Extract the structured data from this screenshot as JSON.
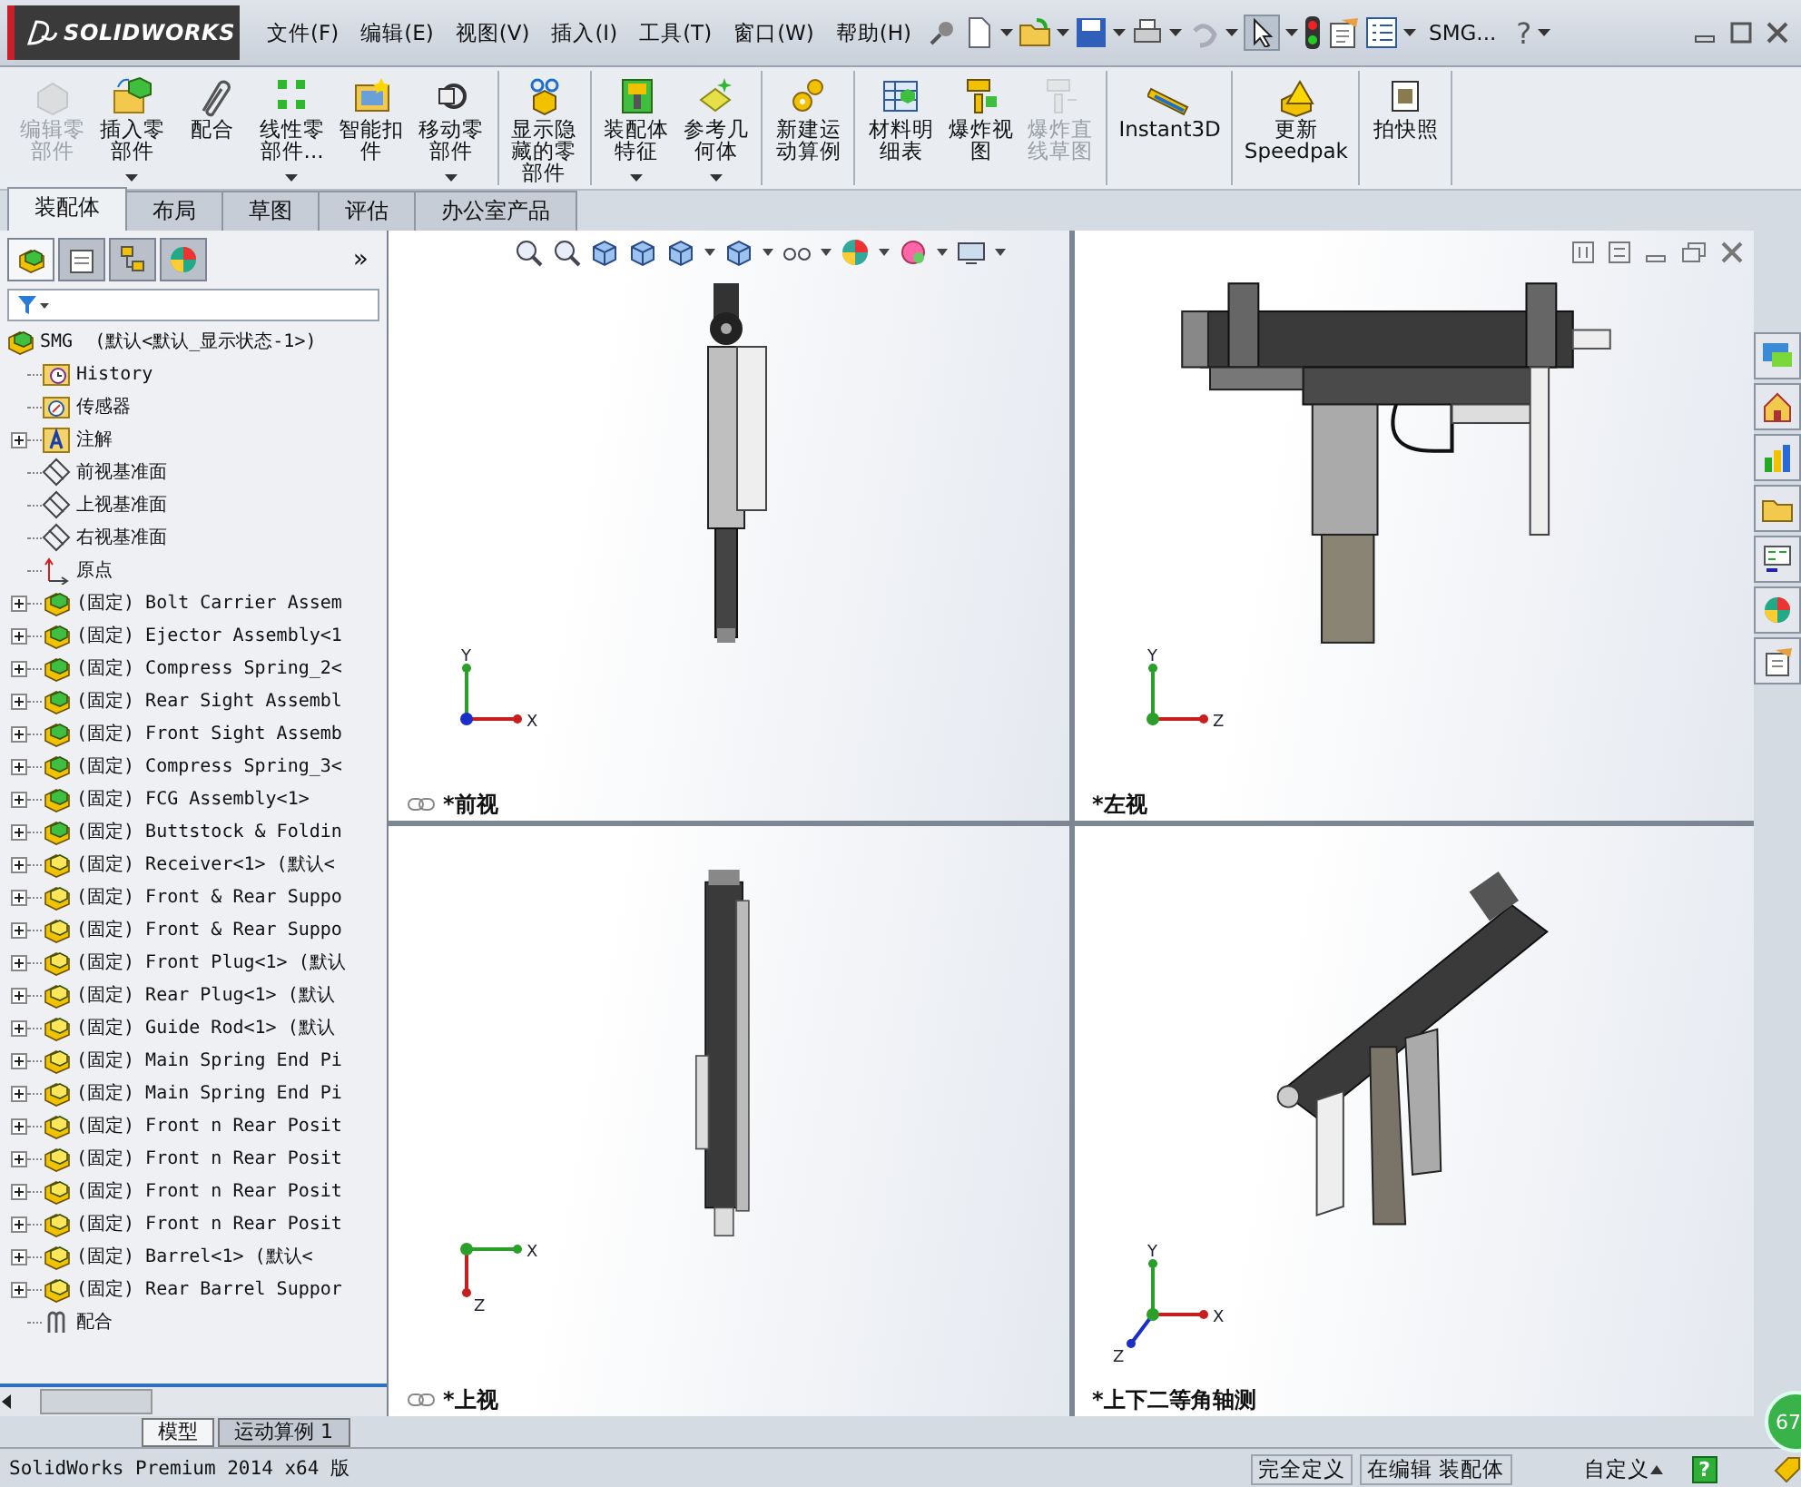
{
  "app": {
    "logo": "SOLIDWORKS"
  },
  "menu": [
    "文件(F)",
    "编辑(E)",
    "视图(V)",
    "插入(I)",
    "工具(T)",
    "窗口(W)",
    "帮助(H)"
  ],
  "document_name": "SMG...",
  "help": "?",
  "commands": [
    [
      {
        "label": "编辑零部件",
        "disabled": true,
        "dropdown": false
      },
      {
        "label": "插入零部件",
        "disabled": false,
        "dropdown": true
      },
      {
        "label": "配合",
        "disabled": false,
        "dropdown": false
      },
      {
        "label": "线性零部件...",
        "disabled": false,
        "dropdown": true
      },
      {
        "label": "智能扣件",
        "disabled": false,
        "dropdown": false
      },
      {
        "label": "移动零部件",
        "disabled": false,
        "dropdown": true
      }
    ],
    [
      {
        "label": "显示隐藏的零部件",
        "disabled": false,
        "dropdown": false
      }
    ],
    [
      {
        "label": "装配体特征",
        "disabled": false,
        "dropdown": true
      },
      {
        "label": "参考几何体",
        "disabled": false,
        "dropdown": true
      }
    ],
    [
      {
        "label": "新建运动算例",
        "disabled": false,
        "dropdown": false
      }
    ],
    [
      {
        "label": "材料明细表",
        "disabled": false,
        "dropdown": false
      },
      {
        "label": "爆炸视图",
        "disabled": false,
        "dropdown": false
      },
      {
        "label": "爆炸直线草图",
        "disabled": true,
        "dropdown": false
      }
    ],
    [
      {
        "label": "Instant3D",
        "disabled": false,
        "dropdown": false
      }
    ],
    [
      {
        "label": "更新Speedpak",
        "disabled": false,
        "dropdown": false
      }
    ],
    [
      {
        "label": "拍快照",
        "disabled": false,
        "dropdown": false
      }
    ]
  ],
  "command_tabs": [
    {
      "label": "装配体",
      "selected": true
    },
    {
      "label": "布局",
      "selected": false
    },
    {
      "label": "草图",
      "selected": false
    },
    {
      "label": "评估",
      "selected": false
    },
    {
      "label": "办公室产品",
      "selected": false
    }
  ],
  "panel_tabs": [
    {
      "selected": true
    },
    {
      "selected": false
    },
    {
      "selected": false
    },
    {
      "selected": false
    }
  ],
  "panel_more": "»",
  "tree": [
    {
      "label": "SMG  (默认<默认_显示状态-1>)",
      "kind": "assembly",
      "children": [
        {
          "label": "History",
          "kind": "history",
          "collapsed": false
        },
        {
          "label": "传感器",
          "kind": "sensors",
          "collapsed": false
        },
        {
          "label": "注解",
          "kind": "annotations",
          "collapsed": true
        },
        {
          "label": "前视基准面",
          "kind": "plane",
          "collapsed": false
        },
        {
          "label": "上视基准面",
          "kind": "plane",
          "collapsed": false
        },
        {
          "label": "右视基准面",
          "kind": "plane",
          "collapsed": false
        },
        {
          "label": "原点",
          "kind": "origin",
          "collapsed": false
        },
        {
          "label": "(固定) Bolt Carrier Assem",
          "kind": "assembly",
          "collapsed": true
        },
        {
          "label": "(固定) Ejector Assembly<1",
          "kind": "assembly",
          "collapsed": true
        },
        {
          "label": "(固定) Compress Spring_2<",
          "kind": "assembly",
          "collapsed": true
        },
        {
          "label": "(固定) Rear Sight Assembl",
          "kind": "assembly",
          "collapsed": true
        },
        {
          "label": "(固定) Front Sight Assemb",
          "kind": "assembly",
          "collapsed": true
        },
        {
          "label": "(固定) Compress Spring_3<",
          "kind": "assembly",
          "collapsed": true
        },
        {
          "label": "(固定) FCG Assembly<1>",
          "kind": "assembly",
          "collapsed": true
        },
        {
          "label": "(固定) Buttstock & Foldin",
          "kind": "assembly",
          "collapsed": true
        },
        {
          "label": "(固定) Receiver<1> (默认<",
          "kind": "part",
          "collapsed": true
        },
        {
          "label": "(固定) Front & Rear Suppo",
          "kind": "part",
          "collapsed": true
        },
        {
          "label": "(固定) Front & Rear Suppo",
          "kind": "part",
          "collapsed": true
        },
        {
          "label": "(固定) Front Plug<1> (默认",
          "kind": "part",
          "collapsed": true
        },
        {
          "label": "(固定) Rear Plug<1> (默认",
          "kind": "part",
          "collapsed": true
        },
        {
          "label": "(固定) Guide Rod<1> (默认",
          "kind": "part",
          "collapsed": true
        },
        {
          "label": "(固定) Main Spring End Pi",
          "kind": "part",
          "collapsed": true
        },
        {
          "label": "(固定) Main Spring End Pi",
          "kind": "part",
          "collapsed": true
        },
        {
          "label": "(固定) Front n Rear Posit",
          "kind": "part",
          "collapsed": true
        },
        {
          "label": "(固定) Front n Rear Posit",
          "kind": "part",
          "collapsed": true
        },
        {
          "label": "(固定) Front n Rear Posit",
          "kind": "part",
          "collapsed": true
        },
        {
          "label": "(固定) Front n Rear Posit",
          "kind": "part",
          "collapsed": true
        },
        {
          "label": "(固定) Barrel<1> (默认<",
          "kind": "part",
          "collapsed": true
        },
        {
          "label": "(固定) Rear Barrel Suppor",
          "kind": "part",
          "collapsed": true
        },
        {
          "label": "配合",
          "kind": "mates",
          "collapsed": false
        }
      ]
    }
  ],
  "viewports": [
    {
      "label": "*前视",
      "kind": "front",
      "axes": [
        {
          "label": "Y",
          "kind": "up"
        },
        {
          "label": "X",
          "kind": "right"
        }
      ]
    },
    {
      "label": "*左视",
      "kind": "side",
      "axes": [
        {
          "label": "Y",
          "kind": "up"
        },
        {
          "label": "Z",
          "kind": "right"
        }
      ]
    },
    {
      "label": "*上视",
      "kind": "top",
      "axes": [
        {
          "label": "X",
          "kind": "right"
        },
        {
          "label": "Z",
          "kind": "down"
        }
      ]
    },
    {
      "label": "*上下二等角轴测",
      "kind": "iso",
      "axes": [
        {
          "label": "Y",
          "kind": "up"
        },
        {
          "label": "X",
          "kind": "right"
        },
        {
          "label": "Z",
          "kind": "downleft"
        }
      ]
    }
  ],
  "model_tabs": [
    {
      "label": "模型",
      "selected": true
    },
    {
      "label": "运动算例 1",
      "selected": false
    }
  ],
  "status_bar": {
    "version": "SolidWorks Premium 2014 x64 版",
    "definition": "完全定义",
    "editing": "在编辑 装配体",
    "units": "自定义",
    "help": "?"
  },
  "badge": "67"
}
